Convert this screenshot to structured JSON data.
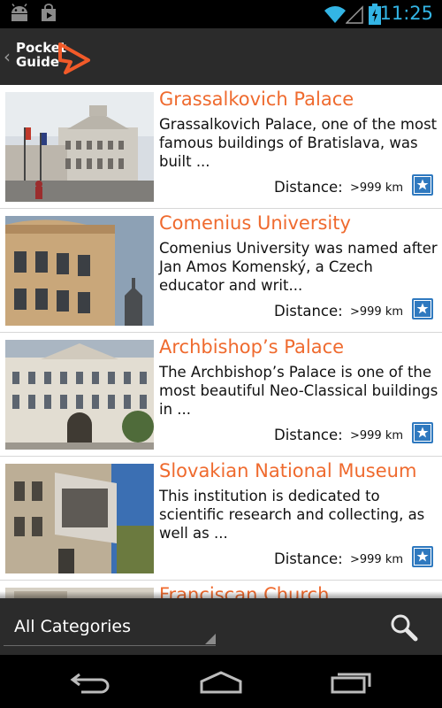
{
  "status_bar": {
    "time": "11:25",
    "left_icons": [
      "android-icon",
      "play-store-icon"
    ],
    "right_icons": [
      "wifi-icon",
      "signal-icon",
      "battery-charging-icon"
    ],
    "accent_color": "#33b5e5"
  },
  "action_bar": {
    "logo_line1": "Pocket",
    "logo_line2": "Guide",
    "logo_color": "#f15a29"
  },
  "list": {
    "title_color": "#ef6a2e",
    "items": [
      {
        "title": "Grassalkovich Palace",
        "description": "Grassalkovich Palace, one of the most famous buildings of Bratislava, was built ...",
        "distance_label": "Distance:",
        "distance_value": ">999 km"
      },
      {
        "title": "Comenius University",
        "description": "Comenius University was named after Jan Amos Komenský, a Czech educator and writ...",
        "distance_label": "Distance:",
        "distance_value": ">999 km"
      },
      {
        "title": "Archbishop’s Palace",
        "description": "The Archbishop’s Palace is one of the most beautiful Neo-Classical buildings in ...",
        "distance_label": "Distance:",
        "distance_value": ">999 km"
      },
      {
        "title": "Slovakian National Museum",
        "description": "This institution is dedicated to scientific research and collecting, as well as ...",
        "distance_label": "Distance:",
        "distance_value": ">999 km"
      },
      {
        "title": "Franciscan Church",
        "description": "",
        "distance_label": "",
        "distance_value": ""
      }
    ]
  },
  "bottom_bar": {
    "category_selected": "All Categories"
  },
  "nav_bar": {
    "buttons": [
      "back-icon",
      "home-icon",
      "recent-apps-icon"
    ]
  }
}
